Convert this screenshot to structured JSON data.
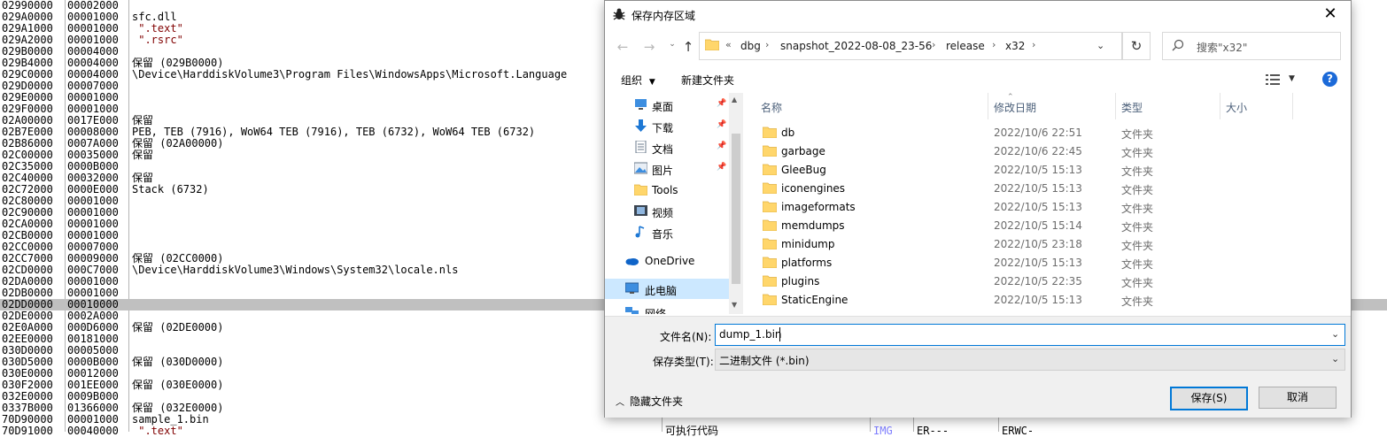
{
  "memory_map": {
    "rows": [
      {
        "addr": "02990000",
        "size": "00002000",
        "info": ""
      },
      {
        "addr": "029A0000",
        "size": "00001000",
        "info": "sfc.dll"
      },
      {
        "addr": "029A1000",
        "size": "00001000",
        "info": " \".text\""
      },
      {
        "addr": "029A2000",
        "size": "00001000",
        "info": " \".rsrc\""
      },
      {
        "addr": "029B0000",
        "size": "00004000",
        "info": ""
      },
      {
        "addr": "029B4000",
        "size": "00004000",
        "info": "保留 (029B0000)"
      },
      {
        "addr": "029C0000",
        "size": "00004000",
        "info": "\\Device\\HarddiskVolume3\\Program Files\\WindowsApps\\Microsoft.Language"
      },
      {
        "addr": "029D0000",
        "size": "00007000",
        "info": ""
      },
      {
        "addr": "029E0000",
        "size": "00001000",
        "info": ""
      },
      {
        "addr": "029F0000",
        "size": "00001000",
        "info": ""
      },
      {
        "addr": "02A00000",
        "size": "0017E000",
        "info": "保留"
      },
      {
        "addr": "02B7E000",
        "size": "00008000",
        "info": "PEB, TEB (7916), WoW64 TEB (7916), TEB (6732), WoW64 TEB (6732)"
      },
      {
        "addr": "02B86000",
        "size": "0007A000",
        "info": "保留 (02A00000)"
      },
      {
        "addr": "02C00000",
        "size": "00035000",
        "info": "保留"
      },
      {
        "addr": "02C35000",
        "size": "0000B000",
        "info": ""
      },
      {
        "addr": "02C40000",
        "size": "00032000",
        "info": "保留"
      },
      {
        "addr": "02C72000",
        "size": "0000E000",
        "info": "Stack (6732)"
      },
      {
        "addr": "02C80000",
        "size": "00001000",
        "info": ""
      },
      {
        "addr": "02C90000",
        "size": "00001000",
        "info": ""
      },
      {
        "addr": "02CA0000",
        "size": "00001000",
        "info": ""
      },
      {
        "addr": "02CB0000",
        "size": "00001000",
        "info": ""
      },
      {
        "addr": "02CC0000",
        "size": "00007000",
        "info": ""
      },
      {
        "addr": "02CC7000",
        "size": "00009000",
        "info": "保留 (02CC0000)"
      },
      {
        "addr": "02CD0000",
        "size": "000C7000",
        "info": "\\Device\\HarddiskVolume3\\Windows\\System32\\locale.nls"
      },
      {
        "addr": "02DA0000",
        "size": "00001000",
        "info": ""
      },
      {
        "addr": "02DB0000",
        "size": "00001000",
        "info": ""
      },
      {
        "addr": "02DD0000",
        "size": "00010000",
        "info": ""
      },
      {
        "addr": "02DE0000",
        "size": "0002A000",
        "info": ""
      },
      {
        "addr": "02E0A000",
        "size": "000D6000",
        "info": "保留 (02DE0000)"
      },
      {
        "addr": "02EE0000",
        "size": "00181000",
        "info": ""
      },
      {
        "addr": "030D0000",
        "size": "00005000",
        "info": ""
      },
      {
        "addr": "030D5000",
        "size": "0000B000",
        "info": "保留 (030D0000)"
      },
      {
        "addr": "030E0000",
        "size": "00012000",
        "info": ""
      },
      {
        "addr": "030F2000",
        "size": "001EE000",
        "info": "保留 (030E0000)"
      },
      {
        "addr": "032E0000",
        "size": "0009B000",
        "info": ""
      },
      {
        "addr": "0337B000",
        "size": "01366000",
        "info": "保留 (032E0000)"
      },
      {
        "addr": "70D90000",
        "size": "00001000",
        "info": "sample_1.bin"
      },
      {
        "addr": "70D91000",
        "size": "00040000",
        "info": " \".text\"",
        "type": "可执行代码",
        "kind": "IMG",
        "prot": "ER---",
        "init": "ERWC-"
      }
    ]
  },
  "dialog": {
    "title": "保存内存区域",
    "breadcrumb": [
      "dbg",
      "snapshot_2022-08-08_23-56",
      "release",
      "x32"
    ],
    "breadcrumb_prefix": "«",
    "search_placeholder": "搜索\"x32\"",
    "toolbar": {
      "organize": "组织",
      "new_folder": "新建文件夹"
    },
    "nav_items": [
      {
        "label": "桌面",
        "icon": "desktop-icon",
        "pinned": true
      },
      {
        "label": "下载",
        "icon": "download-icon",
        "pinned": true
      },
      {
        "label": "文档",
        "icon": "documents-icon",
        "pinned": true
      },
      {
        "label": "图片",
        "icon": "pictures-icon",
        "pinned": true
      },
      {
        "label": "Tools",
        "icon": "folder-icon",
        "pinned": false
      },
      {
        "label": "视频",
        "icon": "video-icon",
        "pinned": false
      },
      {
        "label": "音乐",
        "icon": "music-icon",
        "pinned": false
      },
      {
        "label": "OneDrive",
        "icon": "onedrive-icon",
        "pinned": false
      },
      {
        "label": "此电脑",
        "icon": "this-pc-icon",
        "pinned": false,
        "selected": true
      },
      {
        "label": "网络",
        "icon": "network-icon",
        "pinned": false
      }
    ],
    "columns": {
      "name": "名称",
      "date": "修改日期",
      "type": "类型",
      "size": "大小"
    },
    "files": [
      {
        "name": "db",
        "date": "2022/10/6 22:51",
        "type": "文件夹"
      },
      {
        "name": "garbage",
        "date": "2022/10/6 22:45",
        "type": "文件夹"
      },
      {
        "name": "GleeBug",
        "date": "2022/10/5 15:13",
        "type": "文件夹"
      },
      {
        "name": "iconengines",
        "date": "2022/10/5 15:13",
        "type": "文件夹"
      },
      {
        "name": "imageformats",
        "date": "2022/10/5 15:13",
        "type": "文件夹"
      },
      {
        "name": "memdumps",
        "date": "2022/10/5 15:14",
        "type": "文件夹"
      },
      {
        "name": "minidump",
        "date": "2022/10/5 23:18",
        "type": "文件夹"
      },
      {
        "name": "platforms",
        "date": "2022/10/5 15:13",
        "type": "文件夹"
      },
      {
        "name": "plugins",
        "date": "2022/10/5 22:35",
        "type": "文件夹"
      },
      {
        "name": "StaticEngine",
        "date": "2022/10/5 15:13",
        "type": "文件夹"
      }
    ],
    "filename_label": "文件名(N):",
    "filename_value": "dump_1.bin",
    "filetype_label": "保存类型(T):",
    "filetype_value": "二进制文件 (*.bin)",
    "hide_folders": "隐藏文件夹",
    "save_label": "保存(S)",
    "cancel_label": "取消"
  },
  "colors": {
    "accent": "#0078d7",
    "selection": "#cce8ff",
    "help": "#1c6ad8",
    "folder": "#ffd66b"
  }
}
